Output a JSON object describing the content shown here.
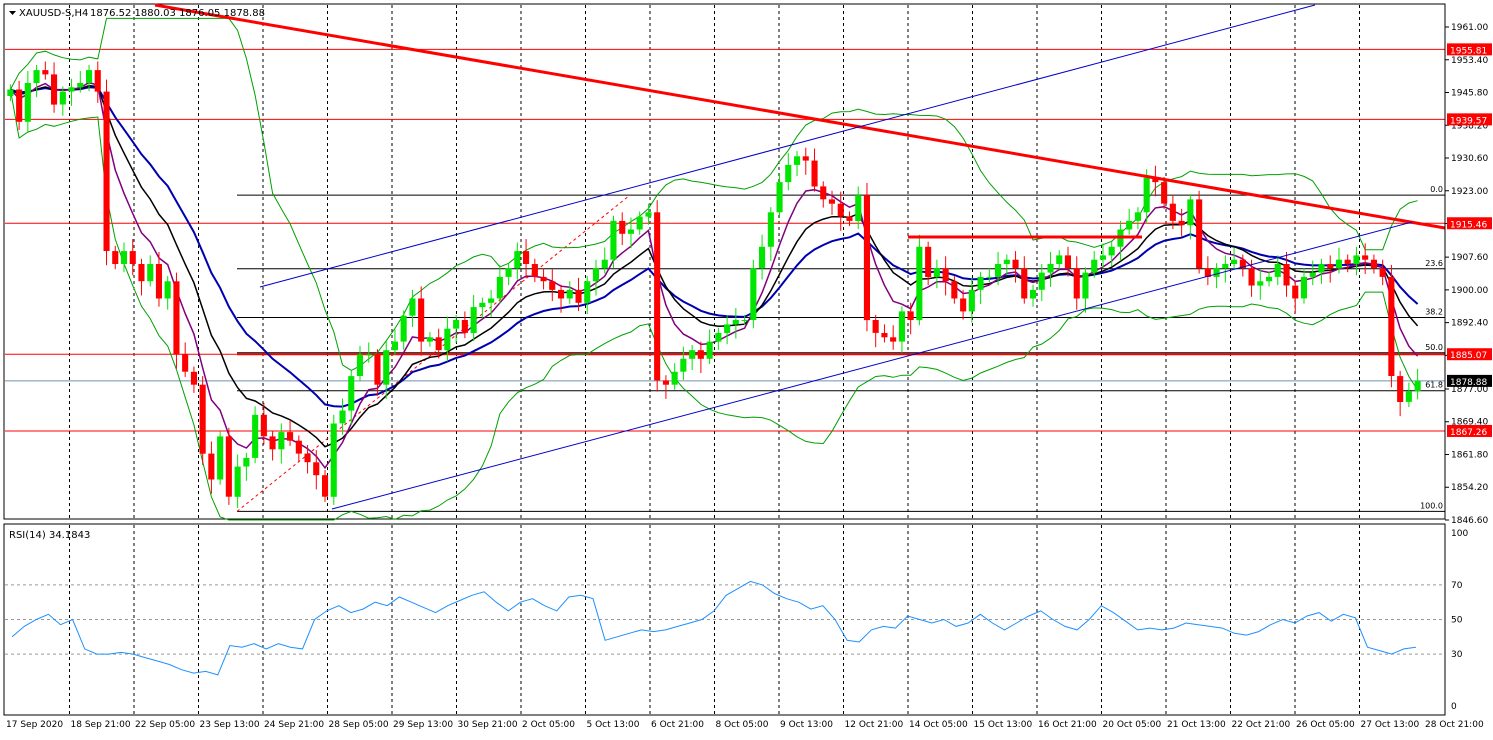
{
  "header": {
    "symbol": "XAUUSD-S,H4",
    "ohlc": "1876.52 1880.03 1876.05 1878.88"
  },
  "rsi_label": "RSI(14) 34.1843",
  "colors": {
    "bull": "#00e600",
    "bear": "#ff0000",
    "trendline": "#ff0000",
    "channel": "#0000cc",
    "ma_fast": "#800080",
    "ma_mid": "#000000",
    "ma_slow": "#0000b0",
    "bollinger": "#00a000",
    "rsi": "#1e90ff",
    "grid": "#000000"
  },
  "chart_data": [
    {
      "type": "candlestick",
      "title": "XAUUSD-S,H4",
      "x_labels": [
        "17 Sep 2020",
        "18 Sep 21:00",
        "22 Sep 05:00",
        "23 Sep 13:00",
        "24 Sep 21:00",
        "28 Sep 05:00",
        "29 Sep 13:00",
        "30 Sep 21:00",
        "2 Oct 05:00",
        "5 Oct 13:00",
        "6 Oct 21:00",
        "8 Oct 05:00",
        "9 Oct 13:00",
        "12 Oct 21:00",
        "14 Oct 05:00",
        "15 Oct 13:00",
        "16 Oct 21:00",
        "20 Oct 05:00",
        "21 Oct 13:00",
        "22 Oct 21:00",
        "26 Oct 05:00",
        "27 Oct 13:00",
        "28 Oct 21:00"
      ],
      "y_ticks": [
        "1961.00",
        "1953.40",
        "1945.80",
        "1938.20",
        "1930.60",
        "1923.00",
        "1915.40",
        "1907.60",
        "1900.00",
        "1892.40",
        "1884.80",
        "1877.00",
        "1869.40",
        "1861.80",
        "1854.20",
        "1846.60"
      ],
      "ylim": [
        1846.6,
        1961.0
      ],
      "price_levels": [
        {
          "value": 1955.81,
          "label": "1955.81"
        },
        {
          "value": 1939.57,
          "label": "1939.57"
        },
        {
          "value": 1915.46,
          "label": "1915.46"
        },
        {
          "value": 1885.07,
          "label": "1885.07"
        },
        {
          "value": 1867.26,
          "label": "1867.26"
        }
      ],
      "current_price": {
        "value": 1878.88,
        "label": "1878.88"
      },
      "fibonacci": [
        {
          "label": "0.0",
          "value": 1922.0
        },
        {
          "label": "23.6",
          "value": 1904.9
        },
        {
          "label": "38.2",
          "value": 1893.6
        },
        {
          "label": "50.0",
          "value": 1885.4
        },
        {
          "label": "61.8",
          "value": 1876.6
        },
        {
          "label": "100.0",
          "value": 1848.6
        }
      ],
      "series": [
        {
          "name": "Close",
          "values": [
            1946.5,
            1939.0,
            1948.0,
            1951.0,
            1950.0,
            1943.0,
            1946.0,
            1947.0,
            1948.0,
            1951.0,
            1946.0,
            1909.0,
            1906.0,
            1909.0,
            1906.0,
            1902.0,
            1906.0,
            1898.0,
            1902.0,
            1885.0,
            1881.0,
            1878.0,
            1862.0,
            1856.0,
            1866.0,
            1852.0,
            1859.0,
            1861.0,
            1871.0,
            1866.0,
            1863.0,
            1867.0,
            1865.0,
            1862.0,
            1860.0,
            1857.0,
            1852.0,
            1869.0,
            1872.0,
            1880.0,
            1885.0,
            1885.0,
            1878.0,
            1886.0,
            1888.0,
            1894.0,
            1898.0,
            1888.0,
            1889.0,
            1886.0,
            1891.0,
            1893.0,
            1890.0,
            1896.0,
            1897.0,
            1898.0,
            1903.0,
            1905.0,
            1909.0,
            1906.0,
            1903.0,
            1902.0,
            1900.0,
            1898.0,
            1900.0,
            1897.0,
            1902.0,
            1905.0,
            1907.0,
            1916.0,
            1913.0,
            1914.0,
            1917.0,
            1918.0,
            1879.0,
            1878.0,
            1881.0,
            1884.0,
            1886.0,
            1884.0,
            1888.0,
            1890.0,
            1892.0,
            1893.0,
            1893.0,
            1905.0,
            1910.0,
            1918.0,
            1925.0,
            1929.0,
            1931.0,
            1930.0,
            1924.0,
            1921.0,
            1920.0,
            1917.0,
            1916.0,
            1922.0,
            1893.0,
            1890.0,
            1889.0,
            1888.0,
            1895.0,
            1893.0,
            1910.0,
            1903.0,
            1905.0,
            1902.0,
            1898.0,
            1895.0,
            1900.0,
            1903.0,
            1903.0,
            1906.0,
            1907.0,
            1905.0,
            1898.0,
            1900.0,
            1904.0,
            1906.0,
            1908.0,
            1905.0,
            1898.0,
            1904.0,
            1907.0,
            1908.0,
            1910.0,
            1914.0,
            1916.0,
            1918.0,
            1926.0,
            1925.0,
            1920.0,
            1916.0,
            1915.0,
            1921.0,
            1905.0,
            1903.0,
            1905.0,
            1906.0,
            1907.0,
            1905.0,
            1901.0,
            1902.0,
            1903.0,
            1906.0,
            1901.0,
            1898.0,
            1903.0,
            1904.0,
            1906.0,
            1905.0,
            1907.0,
            1906.0,
            1908.0,
            1907.0,
            1905.0,
            1903.0,
            1880.0,
            1874.0,
            1876.5,
            1878.88
          ]
        },
        {
          "name": "RSI(14)",
          "values": [
            40,
            46,
            50,
            53,
            47,
            50,
            33,
            30,
            30,
            31,
            30,
            28,
            26,
            24,
            21,
            19,
            20,
            18,
            35,
            34,
            36,
            33,
            36,
            34,
            33,
            50,
            55,
            58,
            54,
            56,
            60,
            58,
            63,
            60,
            57,
            54,
            58,
            61,
            64,
            66,
            60,
            55,
            60,
            62,
            58,
            55,
            63,
            64,
            62,
            38,
            40,
            42,
            44,
            43,
            44,
            46,
            48,
            50,
            55,
            64,
            68,
            72,
            70,
            65,
            62,
            60,
            56,
            58,
            50,
            38,
            37,
            44,
            46,
            45,
            52,
            50,
            48,
            50,
            46,
            48,
            53,
            48,
            44,
            48,
            52,
            55,
            50,
            46,
            44,
            50,
            58,
            54,
            49,
            44,
            45,
            44,
            45,
            48,
            47,
            46,
            45,
            42,
            41,
            43,
            47,
            50,
            48,
            52,
            54,
            49,
            53,
            51,
            34,
            32,
            30,
            33,
            34
          ]
        }
      ]
    }
  ]
}
